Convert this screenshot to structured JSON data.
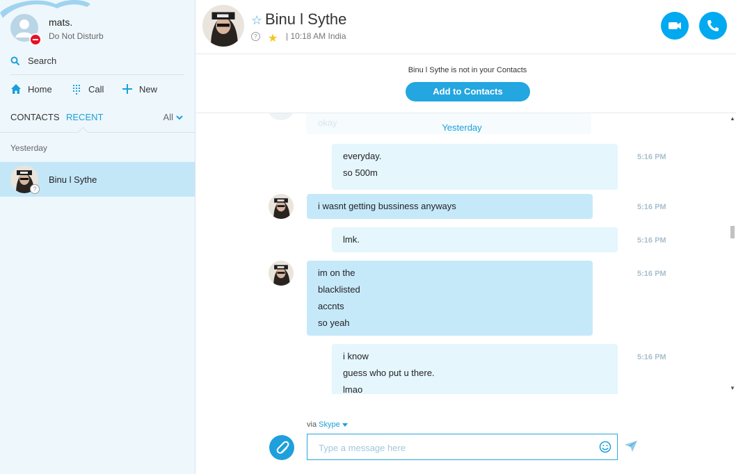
{
  "sidebar": {
    "profile": {
      "name": "mats.",
      "status": "Do Not Disturb"
    },
    "search": {
      "label": "Search"
    },
    "nav": [
      {
        "label": "Home",
        "icon": "home-icon"
      },
      {
        "label": "Call",
        "icon": "dialpad-icon"
      },
      {
        "label": "New",
        "icon": "plus-icon"
      }
    ],
    "tabs": {
      "contacts": "CONTACTS",
      "recent": "RECENT",
      "filter": "All"
    },
    "section_label": "Yesterday",
    "recent_items": [
      {
        "name": "Binu l Sythe"
      }
    ]
  },
  "header": {
    "contact_name": "Binu l Sythe",
    "local_time": "10:18 AM India"
  },
  "banner": {
    "text": "Binu l Sythe is not in your Contacts",
    "button": "Add to Contacts"
  },
  "conversation": {
    "ghost_text": "okay",
    "date_separator": "Yesterday",
    "messages": [
      {
        "direction": "out",
        "lines": [
          "everyday.",
          "so 500m"
        ],
        "time": "5:16 PM"
      },
      {
        "direction": "in",
        "lines": [
          "i wasnt getting bussiness anyways"
        ],
        "time": "5:16 PM"
      },
      {
        "direction": "out",
        "lines": [
          "lmk."
        ],
        "time": "5:16 PM"
      },
      {
        "direction": "in",
        "lines": [
          "im on the",
          "blacklisted",
          "accnts",
          "so yeah"
        ],
        "time": "5:16 PM"
      },
      {
        "direction": "out",
        "lines": [
          "i know",
          "guess who put u there.",
          "lmao"
        ],
        "time": "5:16 PM"
      }
    ]
  },
  "compose": {
    "via_prefix": "via",
    "via_service": "Skype",
    "placeholder": "Type a message here"
  },
  "colors": {
    "accent": "#00a9f0",
    "selected": "#c4e7f8",
    "incoming": "#c6e9fa",
    "outgoing": "#e5f6fd"
  }
}
